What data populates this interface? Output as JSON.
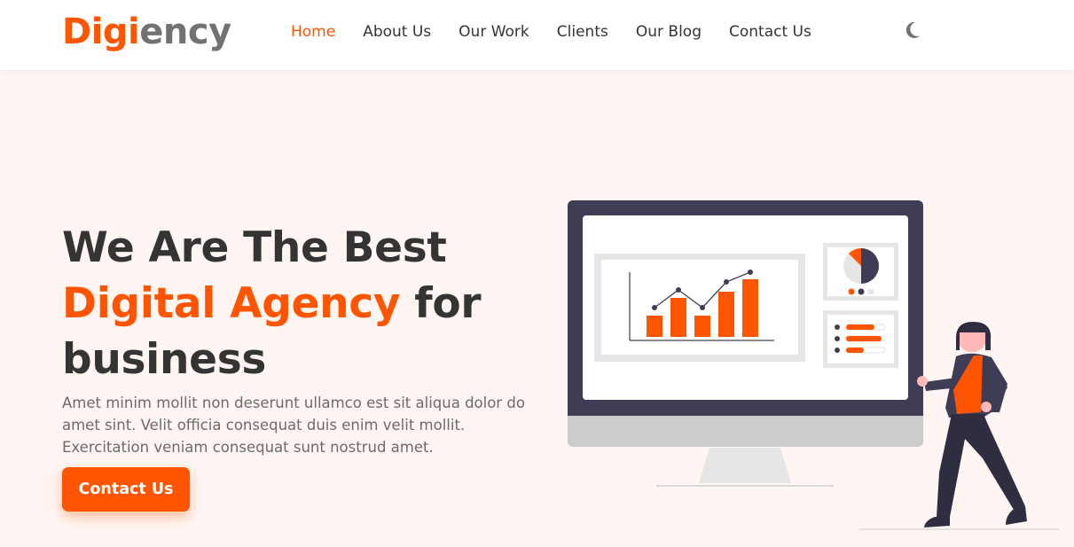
{
  "brand": {
    "part1": "Digi",
    "part2": "ency"
  },
  "nav": [
    {
      "label": "Home",
      "active": true
    },
    {
      "label": "About Us",
      "active": false
    },
    {
      "label": "Our Work",
      "active": false
    },
    {
      "label": "Clients",
      "active": false
    },
    {
      "label": "Our Blog",
      "active": false
    },
    {
      "label": "Contact Us",
      "active": false
    }
  ],
  "theme_toggle": {
    "icon": "moon-icon"
  },
  "hero": {
    "title_line1": "We Are The Best",
    "title_accent": "Digital Agency",
    "title_tail": "for",
    "title_line3": "business",
    "text": "Amet minim mollit non deserunt ullamco est sit aliqua dolor do amet sint. Velit officia consequat duis enim velit mollit. Exercitation veniam consequat sunt nostrud amet.",
    "cta_label": "Contact Us"
  },
  "colors": {
    "accent": "#ff5400",
    "text_dark": "#343434",
    "hero_bg": "#fff6f3",
    "monitor": "#3f3d56"
  }
}
